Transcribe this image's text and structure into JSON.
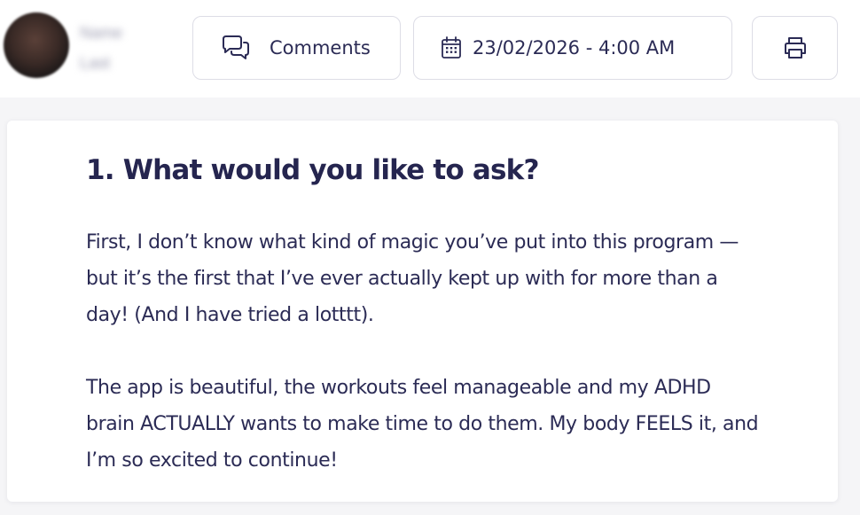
{
  "user": {
    "name_line1": "Name",
    "name_line2": "Last"
  },
  "toolbar": {
    "comments_label": "Comments",
    "date_label": "23/02/2026 - 4:00 AM",
    "comments_icon": "chat-bubbles-icon",
    "date_icon": "calendar-icon",
    "print_icon": "printer-icon"
  },
  "question": {
    "title": "1. What would you like to ask?",
    "paragraphs": [
      "First, I don’t know what kind of magic you’ve put into this program — but it’s the first that I’ve ever actually kept up with for more than a day! (And I have tried a lotttt).",
      "The app is beautiful, the workouts feel manageable and my ADHD brain ACTUALLY wants to make time to do them. My body FEELS it, and I’m so excited to continue!"
    ]
  },
  "colors": {
    "text": "#2b2b55",
    "border": "#dddde6",
    "background": "#f5f5f7"
  }
}
